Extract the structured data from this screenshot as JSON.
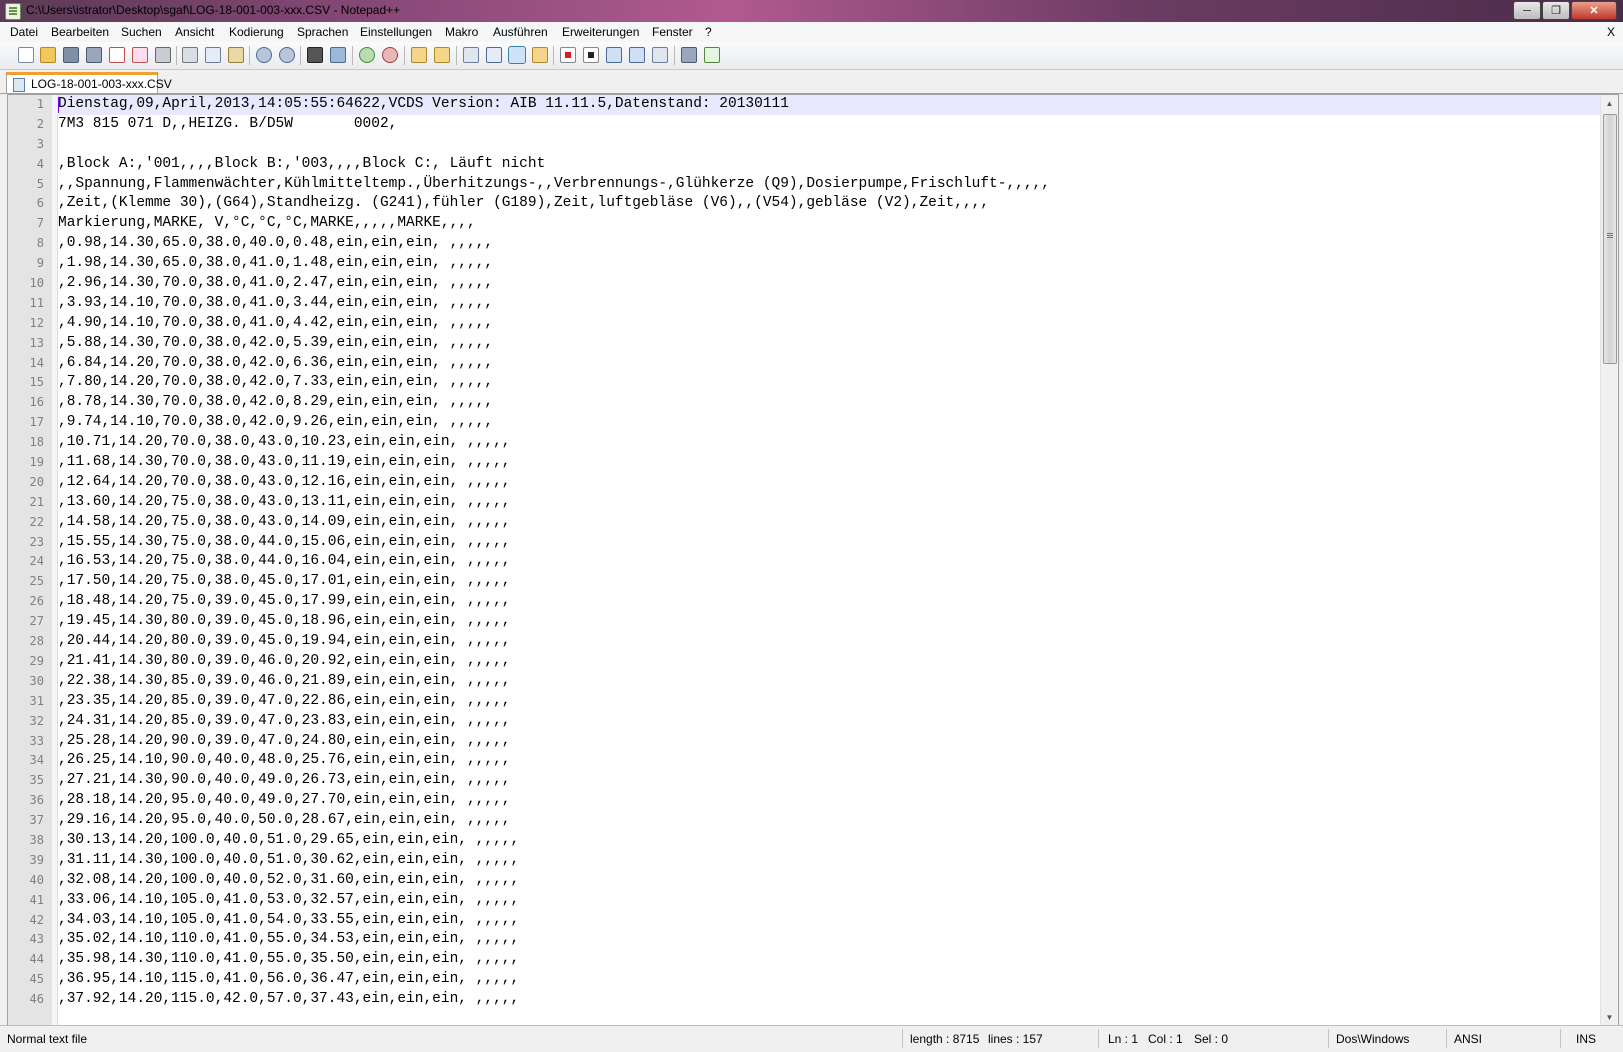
{
  "window": {
    "title": "C:\\Users\\istrator\\Desktop\\sgaf\\LOG-18-001-003-xxx.CSV - Notepad++",
    "min_glyph": "─",
    "max_glyph": "❐",
    "close_glyph": "✕"
  },
  "menu": {
    "items": [
      "Datei",
      "Bearbeiten",
      "Suchen",
      "Ansicht",
      "Kodierung",
      "Sprachen",
      "Einstellungen",
      "Makro",
      "Ausführen",
      "Erweiterungen",
      "Fenster",
      "?"
    ],
    "doc_close": "X"
  },
  "toolbar": {
    "icons": [
      "new-file-icon",
      "open-file-icon",
      "save-icon",
      "save-all-icon",
      "close-file-icon",
      "close-all-icon",
      "print-icon",
      "cut-icon",
      "copy-icon",
      "paste-icon",
      "undo-icon",
      "redo-icon",
      "find-icon",
      "replace-icon",
      "zoom-in-icon",
      "zoom-out-icon",
      "sync-vertical-icon",
      "sync-horizontal-icon",
      "word-wrap-icon",
      "show-all-chars-icon",
      "indent-guide-icon",
      "doc-map-icon",
      "record-macro-icon",
      "stop-macro-icon",
      "play-macro-icon",
      "run-macro-multiple-icon",
      "save-macro-icon",
      "launch-browser-icon",
      "spell-check-icon"
    ]
  },
  "tab": {
    "label": "LOG-18-001-003-xxx.CSV"
  },
  "editor": {
    "lines": [
      {
        "n": "1",
        "text": "Dienstag,09,April,2013,14:05:55:64622,VCDS Version: AIB 11.11.5,Datenstand: 20130111"
      },
      {
        "n": "2",
        "text": "7M3 815 071 D,,HEIZG. B/D5W       0002,"
      },
      {
        "n": "3",
        "text": ""
      },
      {
        "n": "4",
        "text": ",Block A:,'001,,,,Block B:,'003,,,,Block C:, Läuft nicht"
      },
      {
        "n": "5",
        "text": ",,Spannung,Flammenwächter,Kühlmitteltemp.,Überhitzungs-,,Verbrennungs-,Glühkerze (Q9),Dosierpumpe,Frischluft-,,,,,"
      },
      {
        "n": "6",
        "text": ",Zeit,(Klemme 30),(G64),Standheizg. (G241),fühler (G189),Zeit,luftgebläse (V6),,(V54),gebläse (V2),Zeit,,,,"
      },
      {
        "n": "7",
        "text": "Markierung,MARKE, V,°C,°C,°C,MARKE,,,,,MARKE,,,,"
      },
      {
        "n": "8",
        "text": ",0.98,14.30,65.0,38.0,40.0,0.48,ein,ein,ein, ,,,,,"
      },
      {
        "n": "9",
        "text": ",1.98,14.30,65.0,38.0,41.0,1.48,ein,ein,ein, ,,,,,"
      },
      {
        "n": "10",
        "text": ",2.96,14.30,70.0,38.0,41.0,2.47,ein,ein,ein, ,,,,,"
      },
      {
        "n": "11",
        "text": ",3.93,14.10,70.0,38.0,41.0,3.44,ein,ein,ein, ,,,,,"
      },
      {
        "n": "12",
        "text": ",4.90,14.10,70.0,38.0,41.0,4.42,ein,ein,ein, ,,,,,"
      },
      {
        "n": "13",
        "text": ",5.88,14.30,70.0,38.0,42.0,5.39,ein,ein,ein, ,,,,,"
      },
      {
        "n": "14",
        "text": ",6.84,14.20,70.0,38.0,42.0,6.36,ein,ein,ein, ,,,,,"
      },
      {
        "n": "15",
        "text": ",7.80,14.20,70.0,38.0,42.0,7.33,ein,ein,ein, ,,,,,"
      },
      {
        "n": "16",
        "text": ",8.78,14.30,70.0,38.0,42.0,8.29,ein,ein,ein, ,,,,,"
      },
      {
        "n": "17",
        "text": ",9.74,14.10,70.0,38.0,42.0,9.26,ein,ein,ein, ,,,,,"
      },
      {
        "n": "18",
        "text": ",10.71,14.20,70.0,38.0,43.0,10.23,ein,ein,ein, ,,,,,"
      },
      {
        "n": "19",
        "text": ",11.68,14.30,70.0,38.0,43.0,11.19,ein,ein,ein, ,,,,,"
      },
      {
        "n": "20",
        "text": ",12.64,14.20,70.0,38.0,43.0,12.16,ein,ein,ein, ,,,,,"
      },
      {
        "n": "21",
        "text": ",13.60,14.20,75.0,38.0,43.0,13.11,ein,ein,ein, ,,,,,"
      },
      {
        "n": "22",
        "text": ",14.58,14.20,75.0,38.0,43.0,14.09,ein,ein,ein, ,,,,,"
      },
      {
        "n": "23",
        "text": ",15.55,14.30,75.0,38.0,44.0,15.06,ein,ein,ein, ,,,,,"
      },
      {
        "n": "24",
        "text": ",16.53,14.20,75.0,38.0,44.0,16.04,ein,ein,ein, ,,,,,"
      },
      {
        "n": "25",
        "text": ",17.50,14.20,75.0,38.0,45.0,17.01,ein,ein,ein, ,,,,,"
      },
      {
        "n": "26",
        "text": ",18.48,14.20,75.0,39.0,45.0,17.99,ein,ein,ein, ,,,,,"
      },
      {
        "n": "27",
        "text": ",19.45,14.30,80.0,39.0,45.0,18.96,ein,ein,ein, ,,,,,"
      },
      {
        "n": "28",
        "text": ",20.44,14.20,80.0,39.0,45.0,19.94,ein,ein,ein, ,,,,,"
      },
      {
        "n": "29",
        "text": ",21.41,14.30,80.0,39.0,46.0,20.92,ein,ein,ein, ,,,,,"
      },
      {
        "n": "30",
        "text": ",22.38,14.30,85.0,39.0,46.0,21.89,ein,ein,ein, ,,,,,"
      },
      {
        "n": "31",
        "text": ",23.35,14.20,85.0,39.0,47.0,22.86,ein,ein,ein, ,,,,,"
      },
      {
        "n": "32",
        "text": ",24.31,14.20,85.0,39.0,47.0,23.83,ein,ein,ein, ,,,,,"
      },
      {
        "n": "33",
        "text": ",25.28,14.20,90.0,39.0,47.0,24.80,ein,ein,ein, ,,,,,"
      },
      {
        "n": "34",
        "text": ",26.25,14.10,90.0,40.0,48.0,25.76,ein,ein,ein, ,,,,,"
      },
      {
        "n": "35",
        "text": ",27.21,14.30,90.0,40.0,49.0,26.73,ein,ein,ein, ,,,,,"
      },
      {
        "n": "36",
        "text": ",28.18,14.20,95.0,40.0,49.0,27.70,ein,ein,ein, ,,,,,"
      },
      {
        "n": "37",
        "text": ",29.16,14.20,95.0,40.0,50.0,28.67,ein,ein,ein, ,,,,,"
      },
      {
        "n": "38",
        "text": ",30.13,14.20,100.0,40.0,51.0,29.65,ein,ein,ein, ,,,,,"
      },
      {
        "n": "39",
        "text": ",31.11,14.30,100.0,40.0,51.0,30.62,ein,ein,ein, ,,,,,"
      },
      {
        "n": "40",
        "text": ",32.08,14.20,100.0,40.0,52.0,31.60,ein,ein,ein, ,,,,,"
      },
      {
        "n": "41",
        "text": ",33.06,14.10,105.0,41.0,53.0,32.57,ein,ein,ein, ,,,,,"
      },
      {
        "n": "42",
        "text": ",34.03,14.10,105.0,41.0,54.0,33.55,ein,ein,ein, ,,,,,"
      },
      {
        "n": "43",
        "text": ",35.02,14.10,110.0,41.0,55.0,34.53,ein,ein,ein, ,,,,,"
      },
      {
        "n": "44",
        "text": ",35.98,14.30,110.0,41.0,55.0,35.50,ein,ein,ein, ,,,,,"
      },
      {
        "n": "45",
        "text": ",36.95,14.10,115.0,41.0,56.0,36.47,ein,ein,ein, ,,,,,"
      },
      {
        "n": "46",
        "text": ",37.92,14.20,115.0,42.0,57.0,37.43,ein,ein,ein, ,,,,,"
      }
    ],
    "current_line": 1
  },
  "status": {
    "filetype": "Normal text file",
    "length": "length : 8715",
    "lines": "lines : 157",
    "ln": "Ln : 1",
    "col": "Col : 1",
    "sel": "Sel : 0",
    "eol": "Dos\\Windows",
    "encoding": "ANSI",
    "mode": "INS"
  },
  "colors": {
    "current_line": "#e8e8ff",
    "caret": "#8000ff",
    "tab_accent": "#f0a030",
    "gutter": "#e4e4e4"
  }
}
